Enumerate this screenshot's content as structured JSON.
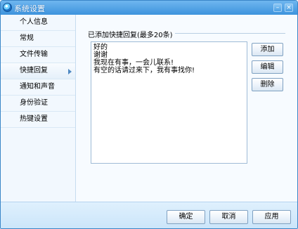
{
  "window": {
    "title": "系统设置",
    "minimize_glyph": "–",
    "close_glyph": "×"
  },
  "sidebar": {
    "items": [
      {
        "label": "个人信息"
      },
      {
        "label": "常规"
      },
      {
        "label": "文件传输"
      },
      {
        "label": "快捷回复",
        "selected": true
      },
      {
        "label": "通知和声音"
      },
      {
        "label": "身份验证"
      },
      {
        "label": "热键设置"
      }
    ]
  },
  "main": {
    "section_title": "已添加快捷回复(最多20条)",
    "replies": [
      "好的",
      "谢谢",
      "我现在有事，一会儿联系!",
      "有空的话请过来下，我有事找你!"
    ],
    "buttons": {
      "add": "添加",
      "edit": "编辑",
      "delete": "删除"
    }
  },
  "footer": {
    "ok": "确定",
    "cancel": "取消",
    "apply": "应用"
  },
  "colors": {
    "titlebar": "#3d93dd",
    "border": "#3a86c8",
    "footer": "#cbe5fa"
  },
  "icons": {
    "app": "qq-logo-icon",
    "selected_indicator": "chevron-right-icon"
  }
}
